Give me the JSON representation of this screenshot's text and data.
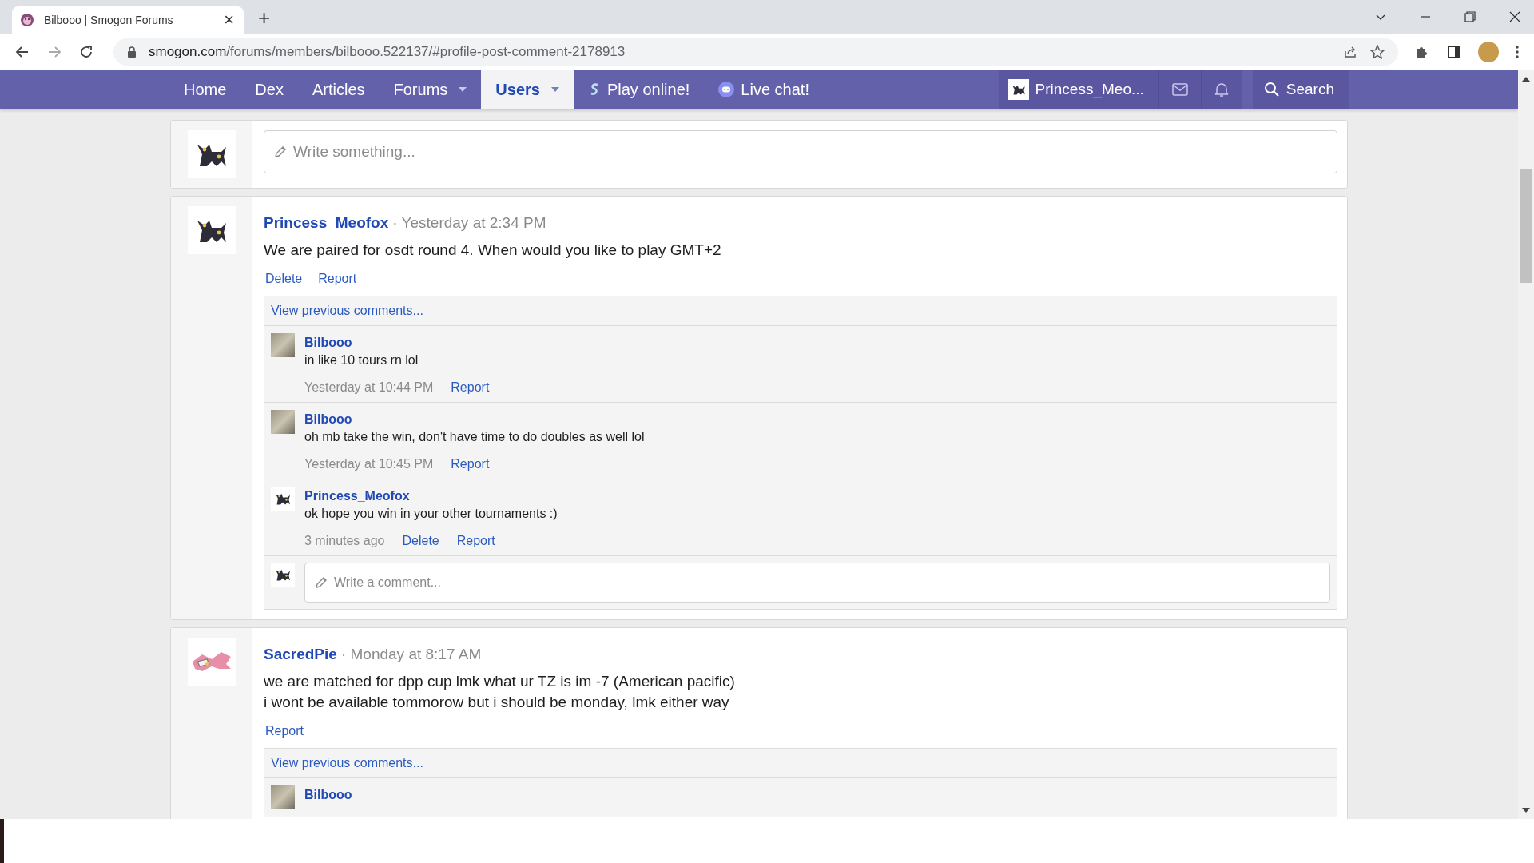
{
  "browser": {
    "tab_title": "Bilbooo | Smogon Forums",
    "tab_close": "×",
    "new_tab": "+",
    "url_domain": "smogon.com",
    "url_path": "/forums/members/bilbooo.522137/#profile-post-comment-2178913"
  },
  "nav": {
    "items": [
      {
        "label": "Home",
        "selected": false,
        "dropdown": false,
        "kind": "plain"
      },
      {
        "label": "Dex",
        "selected": false,
        "dropdown": false,
        "kind": "plain"
      },
      {
        "label": "Articles",
        "selected": false,
        "dropdown": false,
        "kind": "plain"
      },
      {
        "label": "Forums",
        "selected": false,
        "dropdown": true,
        "kind": "plain"
      },
      {
        "label": "Users",
        "selected": true,
        "dropdown": true,
        "kind": "plain"
      },
      {
        "label": "Play online!",
        "selected": false,
        "dropdown": false,
        "kind": "showdown"
      },
      {
        "label": "Live chat!",
        "selected": false,
        "dropdown": false,
        "kind": "discord"
      }
    ],
    "user": "Princess_Meo...",
    "search": "Search"
  },
  "composer": {
    "avatar": {
      "kind": "umbreon"
    },
    "placeholder": "Write something..."
  },
  "posts": [
    {
      "avatar": {
        "kind": "umbreon"
      },
      "author": "Princess_Meofox",
      "time": "· Yesterday at 2:34 PM",
      "lines": [
        "We are paired for osdt round 4. When would you like to play GMT+2"
      ],
      "actions": [
        "Delete",
        "Report"
      ],
      "previous": "View previous comments...",
      "comments": [
        {
          "avatar": {
            "kind": "photo"
          },
          "author": "Bilbooo",
          "text": "in like 10 tours rn lol",
          "time": "Yesterday at 10:44 PM",
          "actions": [
            "Report"
          ]
        },
        {
          "avatar": {
            "kind": "photo"
          },
          "author": "Bilbooo",
          "text": "oh mb take the win, don't have time to do doubles as well lol",
          "time": "Yesterday at 10:45 PM",
          "actions": [
            "Report"
          ]
        },
        {
          "avatar": {
            "kind": "umbreon"
          },
          "author": "Princess_Meofox",
          "text": "ok hope you win in your other tournaments :)",
          "time": "3 minutes ago",
          "actions": [
            "Delete",
            "Report"
          ]
        }
      ],
      "reply": {
        "avatar": {
          "kind": "umbreon"
        },
        "placeholder": "Write a comment..."
      }
    },
    {
      "avatar": {
        "kind": "pink"
      },
      "author": "SacredPie",
      "time": "· Monday at 8:17 AM",
      "lines": [
        "we are matched for dpp cup lmk what ur TZ is im -7 (American pacific)",
        "i wont be available tommorow but i should be monday, lmk either way"
      ],
      "actions": [
        "Report"
      ],
      "previous": "View previous comments...",
      "comments": [
        {
          "avatar": {
            "kind": "photo"
          },
          "author": "Bilbooo"
        }
      ]
    }
  ]
}
